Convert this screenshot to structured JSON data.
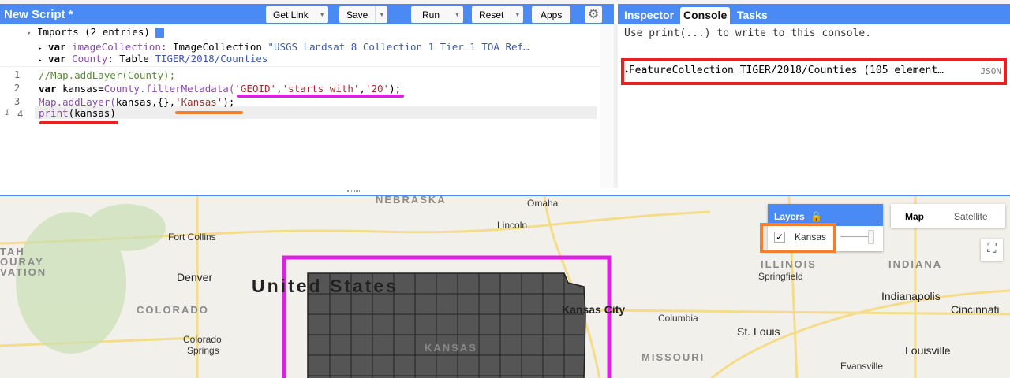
{
  "editor": {
    "title": "New Script *",
    "buttons": {
      "get_link": "Get Link",
      "save": "Save",
      "run": "Run",
      "reset": "Reset",
      "apps": "Apps"
    },
    "imports_header": "Imports (2 entries)",
    "imports": [
      {
        "kw": "var",
        "name": "imageCollection",
        "type": ": ImageCollection ",
        "value": "\"USGS Landsat 8 Collection 1 Tier 1 TOA Ref…"
      },
      {
        "kw": "var",
        "name": "County",
        "type": ": Table ",
        "value": "TIGER/2018/Counties"
      }
    ],
    "lines": [
      "1",
      "2",
      "3",
      "4"
    ],
    "code": {
      "l1": "//Map.addLayer(County);",
      "l2a": "var",
      "l2b": " kansas=",
      "l2c": "County.filterMetadata(",
      "l2d": "'GEOID'",
      "l2e": ",",
      "l2f": "'starts with'",
      "l2g": ",",
      "l2h": "'20'",
      "l2i": ");",
      "l3a": "Map.addLayer(",
      "l3b": "kansas,{},",
      "l3c": "'Kansas'",
      "l3d": ");",
      "l4a": "print",
      "l4b": "(kansas)"
    }
  },
  "console": {
    "tabs": [
      "Inspector",
      "Console",
      "Tasks"
    ],
    "hint": "Use print(...) to write to this console.",
    "output": "FeatureCollection TIGER/2018/Counties (105 element…",
    "json": "JSON"
  },
  "map": {
    "layers_title": "Layers",
    "layer": "Kansas",
    "map_btn": "Map",
    "satellite_btn": "Satellite",
    "labels": {
      "nebraska": "NEBRASKA",
      "omaha": "Omaha",
      "lincoln": "Lincoln",
      "fort_collins": "Fort Collins",
      "denver": "Denver",
      "colorado": "COLORADO",
      "colorado_springs_1": "Colorado",
      "colorado_springs_2": "Springs",
      "us": "United States",
      "kansas_city": "Kansas City",
      "kansas": "KANSAS",
      "columbia": "Columbia",
      "st_louis": "St. Louis",
      "missouri": "MISSOURI",
      "illinois": "ILLINOIS",
      "springfield": "Springfield",
      "indiana": "INDIANA",
      "indianapolis": "Indianapolis",
      "cincinnati": "Cincinnati",
      "louisville": "Louisville",
      "evansville": "Evansville",
      "utah1": "TAH",
      "utah2": "OURAY",
      "utah3": "VATION"
    }
  },
  "colors": {
    "accent": "#4a8af4",
    "magenta": "#e020e0",
    "orange": "#f08030",
    "red": "#e82020"
  }
}
